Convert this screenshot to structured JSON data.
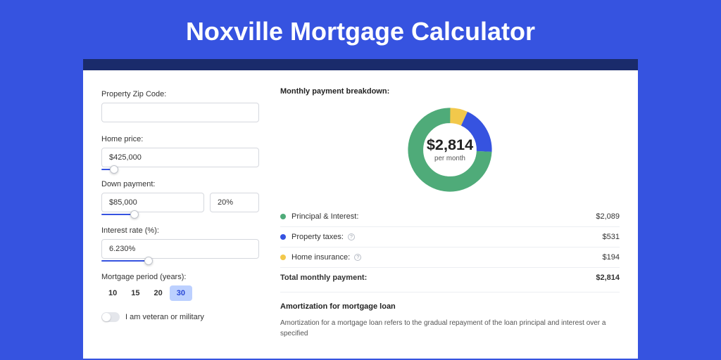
{
  "chart_data": {
    "type": "pie",
    "title": "Monthly payment breakdown",
    "center_value": "$2,814",
    "center_sub": "per month",
    "series": [
      {
        "name": "Principal & Interest",
        "value": 2089,
        "color": "#4fab79"
      },
      {
        "name": "Property taxes",
        "value": 531,
        "color": "#3653e0"
      },
      {
        "name": "Home insurance",
        "value": 194,
        "color": "#f2c84b"
      }
    ],
    "total": {
      "label": "Total monthly payment:",
      "value": "$2,814"
    }
  },
  "header": {
    "title": "Noxville Mortgage Calculator"
  },
  "form": {
    "zip": {
      "label": "Property Zip Code:",
      "value": ""
    },
    "home_price": {
      "label": "Home price:",
      "value": "$425,000",
      "slider_pct": 8
    },
    "down_payment": {
      "label": "Down payment:",
      "value": "$85,000",
      "pct_value": "20%",
      "slider_pct": 20
    },
    "interest_rate": {
      "label": "Interest rate (%):",
      "value": "6.230%",
      "slider_pct": 30
    },
    "period": {
      "label": "Mortgage period (years):",
      "options": [
        "10",
        "15",
        "20",
        "30"
      ],
      "selected": "30"
    },
    "veteran": {
      "label": "I am veteran or military",
      "checked": false
    }
  },
  "breakdown": {
    "title": "Monthly payment breakdown:",
    "center_value": "$2,814",
    "center_sub": "per month",
    "items": [
      {
        "label": "Principal & Interest:",
        "value": "$2,089",
        "color": "#4fab79"
      },
      {
        "label": "Property taxes:",
        "value": "$531",
        "color": "#3653e0",
        "help": true
      },
      {
        "label": "Home insurance:",
        "value": "$194",
        "color": "#f2c84b",
        "help": true
      }
    ],
    "total": {
      "label": "Total monthly payment:",
      "value": "$2,814"
    }
  },
  "amort": {
    "title": "Amortization for mortgage loan",
    "text": "Amortization for a mortgage loan refers to the gradual repayment of the loan principal and interest over a specified"
  }
}
